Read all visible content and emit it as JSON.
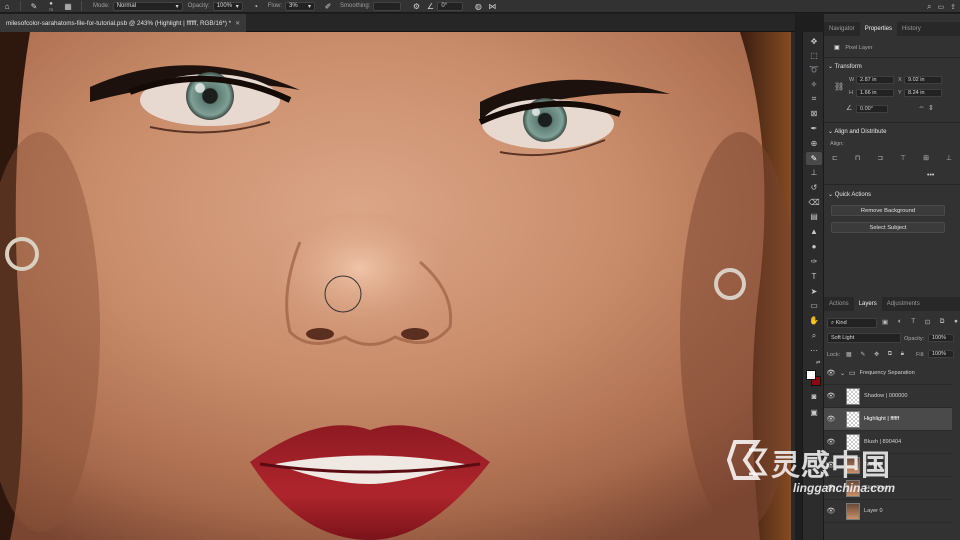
{
  "options_bar": {
    "brush_size": "70",
    "mode_label": "Mode:",
    "mode_value": "Normal",
    "opacity_label": "Opacity:",
    "opacity_value": "100%",
    "flow_label": "Flow:",
    "flow_value": "3%",
    "smoothing_label": "Smoothing:",
    "angle_value": "0°"
  },
  "document_tab": {
    "title": "milesofcolor-sarahatoms-file-for-tutorial.psb @ 243% (Highlight | ffffff, RGB/16*) *"
  },
  "panel_tabs_top": [
    "Navigator",
    "Properties",
    "History"
  ],
  "properties": {
    "kind": "Pixel Layer",
    "transform_title": "Transform",
    "w_label": "W",
    "w_value": "2.87 in",
    "x_label": "X",
    "x_value": "9.02 in",
    "h_label": "H",
    "h_value": "1.66 in",
    "y_label": "Y",
    "y_value": "8.24 in",
    "angle_value": "0.00°",
    "align_title": "Align and Distribute",
    "align_label": "Align:",
    "quick_actions_title": "Quick Actions",
    "remove_bg": "Remove Background",
    "select_subject": "Select Subject"
  },
  "panel_tabs_layers": [
    "Actions",
    "Layers",
    "Adjustments"
  ],
  "layers_panel": {
    "filter_kind": "Kind",
    "blend_mode": "Soft Light",
    "opacity_label": "Opacity:",
    "opacity_value": "100%",
    "lock_label": "Lock:",
    "fill_label": "Fill:",
    "fill_value": "100%",
    "layers": [
      {
        "name": "Frequency Separation",
        "type": "group"
      },
      {
        "name": "Shadow | 000000",
        "type": "layer"
      },
      {
        "name": "Highlight | ffffff",
        "type": "layer",
        "selected": true
      },
      {
        "name": "Blush | 890404",
        "type": "layer"
      },
      {
        "name": "Texture",
        "type": "layer"
      },
      {
        "name": "Skin Tone",
        "type": "layer"
      },
      {
        "name": "Layer 0",
        "type": "photo"
      }
    ]
  },
  "watermark": {
    "chinese": "灵感中国",
    "url": "lingganchina.com"
  }
}
